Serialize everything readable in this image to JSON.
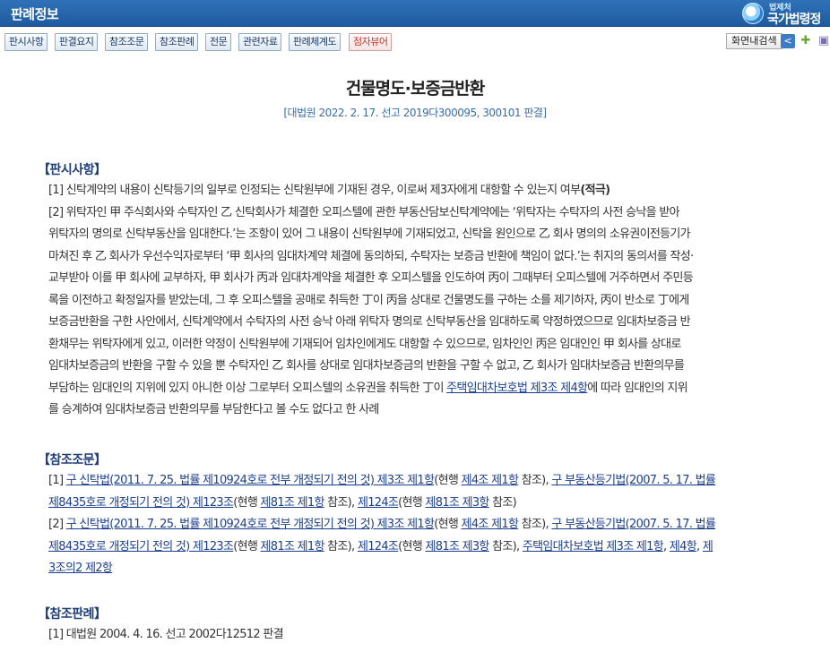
{
  "header": {
    "title": "판례정보",
    "logo_small": "법제처",
    "logo_big": "국가법령정"
  },
  "toolbar": {
    "buttons": [
      "판시사항",
      "판결요지",
      "참조조문",
      "참조판례",
      "전문",
      "관련자료",
      "판례체계도",
      "점자뷰어"
    ],
    "search_label": "화면내검색"
  },
  "document": {
    "title": "건물명도·보증금반환",
    "subtitle": "[대법원 2022. 2. 17. 선고 2019다300095, 300101 판결]"
  },
  "holding": {
    "heading": "【판시사항】",
    "item1_text": "[1] 신탁계약의 내용이 신탁등기의 일부로 인정되는 신탁원부에 기재된 경우, 이로써 제3자에게 대항할 수 있는지 여부",
    "item1_bold": "(적극)",
    "item2_lines": [
      "[2] 위탁자인 甲 주식회사와 수탁자인 乙 신탁회사가 체결한 오피스텔에 관한 부동산담보신탁계약에는 ‘위탁자는 수탁자의 사전 승낙을 받아",
      "위탁자의 명의로 신탁부동산을 임대한다.’는 조항이 있어 그 내용이 신탁원부에 기재되었고, 신탁을 원인으로 乙 회사 명의의 소유권이전등기가",
      "마쳐진 후 乙 회사가 우선수익자로부터 ‘甲 회사의 임대차계약 체결에 동의하되, 수탁자는 보증금 반환에 책임이 없다.’는 취지의 동의서를 작성·",
      "교부받아 이를 甲 회사에 교부하자, 甲 회사가 丙과 임대차계약을 체결한 후 오피스텔을 인도하여 丙이 그때부터 오피스텔에 거주하면서 주민등",
      "록을 이전하고 확정일자를 받았는데, 그 후 오피스텔을 공매로 취득한 丁이 丙을 상대로 건물명도를 구하는 소를 제기하자, 丙이 반소로 丁에게",
      "보증금반환을 구한 사안에서, 신탁계약에서 수탁자의 사전 승낙 아래 위탁자 명의로 신탁부동산을 임대하도록 약정하였으므로 임대차보증금 반",
      "환채무는 위탁자에게 있고, 이러한 약정이 신탁원부에 기재되어 임차인에게도 대항할 수 있으므로, 임차인인 丙은 임대인인 甲 회사를 상대로",
      "임대차보증금의 반환을 구할 수 있을 뿐 수탁자인 乙 회사를 상대로 임대차보증금의 반환을 구할 수 없고, 乙 회사가 임대차보증금 반환의무를"
    ],
    "item2_line9_pre": "부담하는 임대인의 지위에 있지 아니한 이상 그로부터 오피스텔의 소유권을 취득한 丁이 ",
    "item2_line9_link": "주택임대차보호법 제3조 제4항",
    "item2_line9_post": "에 따라 임대인의 지위",
    "item2_line10": "를 승계하여 임대차보증금 반환의무를 부담한다고 볼 수도 없다고 한 사례"
  },
  "references": {
    "heading": "【참조조문】",
    "r1": {
      "prefix": "[1] ",
      "link1": "구 신탁법(2011. 7. 25. 법률 제10924호로 전부 개정되기 전의 것) 제3조 제1항",
      "t1": "(현행 ",
      "link2": "제4조 제1항",
      "t2": " 참조), ",
      "link3": "구 부동산등기법(2007. 5. 17. 법률",
      "link3b": "제8435호로 개정되기 전의 것) 제123조",
      "t3": "(현행 ",
      "link4": "제81조 제1항",
      "t4": " 참조), ",
      "link5": "제124조",
      "t5": "(현행 ",
      "link6": "제81조 제3항",
      "t6": " 참조)"
    },
    "r2": {
      "prefix": "[2] ",
      "link1": "구 신탁법(2011. 7. 25. 법률 제10924호로 전부 개정되기 전의 것) 제3조 제1항",
      "t1": "(현행 ",
      "link2": "제4조 제1항",
      "t2": " 참조), ",
      "link3": "구 부동산등기법(2007. 5. 17. 법률",
      "link3b": "제8435호로 개정되기 전의 것) 제123조",
      "t3": "(현행 ",
      "link4": "제81조 제1항",
      "t4": " 참조), ",
      "link5": "제124조",
      "t5": "(현행 ",
      "link6": "제81조 제3항",
      "t6": " 참조), ",
      "link7": "주택임대차보호법 제3조 제1항",
      "t7": ", ",
      "link8": "제4항",
      "t8": ", ",
      "link9": "제",
      "link9b": "3조의2 제2항"
    }
  },
  "precedents": {
    "heading": "【참조판례】",
    "item1": "[1] 대법원 2004. 4. 16. 선고 2002다12512 판결"
  },
  "colors": {
    "header_blue": "#1f5a9e",
    "heading_navy": "#1f3f7a",
    "link": "#1c3f8f",
    "braille_red": "#c0392b"
  }
}
